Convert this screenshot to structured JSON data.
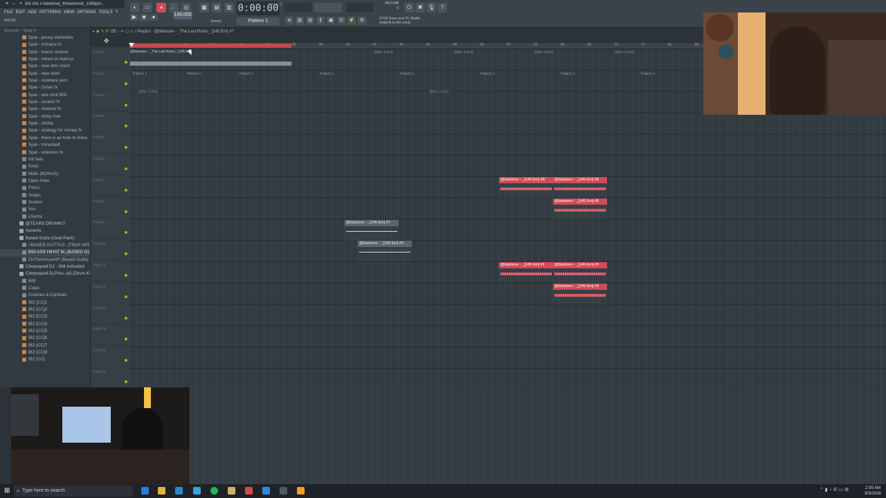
{
  "window": {
    "title": "(fet cho x blaxtone)_thelastronin_145bpm...",
    "song_position": "9:07:21"
  },
  "menu": [
    "FILE",
    "EDIT",
    "ADD",
    "PATTERNS",
    "VIEW",
    "OPTIONS",
    "TOOLS",
    "?"
  ],
  "transport": {
    "time": "0:00:00",
    "time_small": "M:S:CS",
    "tempo": "145.000",
    "pattern": "Pattern 1",
    "snap": "(none)",
    "memory": "4913 MB",
    "memory_line2": "0",
    "cloud_tip_line1": "Save your FL Studio",
    "cloud_tip_line2": "projects to the cloud",
    "cloud_tip_date": "07/15"
  },
  "browser": {
    "header": "Browser - Snap 4",
    "items": [
      {
        "label": "Spat - jersey memories",
        "kind": "file"
      },
      {
        "label": "Spat - m3nace fx",
        "kind": "file"
      },
      {
        "label": "Spat - marco sistemi",
        "kind": "file"
      },
      {
        "label": "Spat - minus or marcus",
        "kind": "file"
      },
      {
        "label": "Spat - new dmr crash",
        "kind": "file"
      },
      {
        "label": "Spat - new siren",
        "kind": "file"
      },
      {
        "label": "Spat - nowhere perc",
        "kind": "file"
      },
      {
        "label": "Spat - Oman fx",
        "kind": "file"
      },
      {
        "label": "Spat - one shot 909",
        "kind": "file"
      },
      {
        "label": "Spat - scratch fx",
        "kind": "file"
      },
      {
        "label": "Spat - shadow fx",
        "kind": "file"
      },
      {
        "label": "Spat - shiny riser",
        "kind": "file"
      },
      {
        "label": "Spat - shotta",
        "kind": "file"
      },
      {
        "label": "Spat - strategy for money fx",
        "kind": "file"
      },
      {
        "label": "Spat - there is an hole in china",
        "kind": "file"
      },
      {
        "label": "Spat - tomasbelt",
        "kind": "file"
      },
      {
        "label": "Spat - velenoso fx",
        "kind": "file"
      },
      {
        "label": "Hit hats",
        "kind": "folder"
      },
      {
        "label": "Kicks",
        "kind": "folder"
      },
      {
        "label": "Midis (BONUS)",
        "kind": "folder"
      },
      {
        "label": "Open Hats",
        "kind": "folder"
      },
      {
        "label": "Percs",
        "kind": "folder"
      },
      {
        "label": "Snaps",
        "kind": "folder"
      },
      {
        "label": "Snares",
        "kind": "folder"
      },
      {
        "label": "Vox",
        "kind": "folder"
      },
      {
        "label": "xTerms",
        "kind": "folder"
      },
      {
        "label": "@TEARS DRUMKIT",
        "kind": "pack"
      },
      {
        "label": "Accents",
        "kind": "pack"
      },
      {
        "label": "Based Gutta (Goat Pack)",
        "kind": "pack"
      },
      {
        "label": "+BASED GUTTA E. (TRAP ARCHIVE)",
        "kind": "folder"
      },
      {
        "label": "BIG ASS HIHAT M..(BASED GUTTA)",
        "kind": "folder",
        "highlight": true
      },
      {
        "label": "OnTheHouseXP (Based Gutta)",
        "kind": "folder"
      },
      {
        "label": "Chopsquad DJ - Still Activated",
        "kind": "pack"
      },
      {
        "label": "Chopsquad Dj Pres..ol2 (Drum Kit)",
        "kind": "pack"
      },
      {
        "label": "808",
        "kind": "folder"
      },
      {
        "label": "Claps",
        "kind": "folder"
      },
      {
        "label": "Crashes & Cymbals",
        "kind": "folder"
      },
      {
        "label": "IB2 [CC]1",
        "kind": "file"
      },
      {
        "label": "IB2 [CC]2",
        "kind": "file"
      },
      {
        "label": "IB2 [CC]3",
        "kind": "file"
      },
      {
        "label": "IB2 [CC]4",
        "kind": "file"
      },
      {
        "label": "IB2 [CC]5",
        "kind": "file"
      },
      {
        "label": "IB2 [CC]6",
        "kind": "file"
      },
      {
        "label": "IB2 [CC]7",
        "kind": "file"
      },
      {
        "label": "IB2 [CC]8",
        "kind": "file"
      },
      {
        "label": "IB2 [CC]",
        "kind": "file"
      }
    ]
  },
  "playlist": {
    "title": "Playlist - @blaxtone - _The Last Ronin_ [145 Em] #7",
    "ruler_numbers": [
      "1",
      "5",
      "9",
      "13",
      "17",
      "21",
      "25",
      "29",
      "33",
      "37",
      "41",
      "45",
      "49",
      "53",
      "57",
      "61",
      "65",
      "69",
      "73",
      "77",
      "81",
      "85"
    ],
    "tracks": [
      "Track 1",
      "Track 2",
      "Track 3",
      "Track 4",
      "Track 5",
      "Track 6",
      "Track 7",
      "Track 8",
      "Track 9",
      "Track 10",
      "Track 11",
      "Track 12",
      "Track 13",
      "Track 14",
      "Track 15",
      "Track 16"
    ],
    "audio_clip_label": "@blaxtone - _The Last Ronin_ [145 Em]",
    "pattern_labels": [
      "Pattern 1",
      "Pattern 1",
      "Pattern 1",
      "Pattern 1",
      "Pattern 1",
      "Pattern 1",
      "Pattern 1",
      "Pattern 1"
    ],
    "faint_clips": [
      "@bla..5 Em]",
      "@bla..5 Em]",
      "@bla..5 Em]",
      "@bla..5 Em]",
      "@bla..5 Em]",
      "@bla..5 Em]"
    ],
    "clips": [
      {
        "label": "@blaxtone - _[145 Em] #8",
        "style": "red"
      },
      {
        "label": "@blaxtone - _[145 Em] #8",
        "style": "red"
      },
      {
        "label": "@blaxtone - _[145 Em] #5",
        "style": "red"
      },
      {
        "label": "@blaxtone - _[145 Em] #7",
        "style": "gray"
      },
      {
        "label": "@blaxtone - _[145 Em] #6",
        "style": "gray"
      },
      {
        "label": "@blaxtone - _[145 Em] #1",
        "style": "red"
      },
      {
        "label": "@blaxtone - _[145 Em] #3",
        "style": "red"
      },
      {
        "label": "@blaxtone - _[145 Em] #4",
        "style": "red"
      }
    ]
  },
  "taskbar": {
    "search_placeholder": "Type here to search",
    "time": "2:05 AM",
    "date": "8/3/2026"
  },
  "colors": {
    "clip_red": "#d14b57",
    "accent_green": "#7ec235",
    "bg": "#2b3339"
  }
}
